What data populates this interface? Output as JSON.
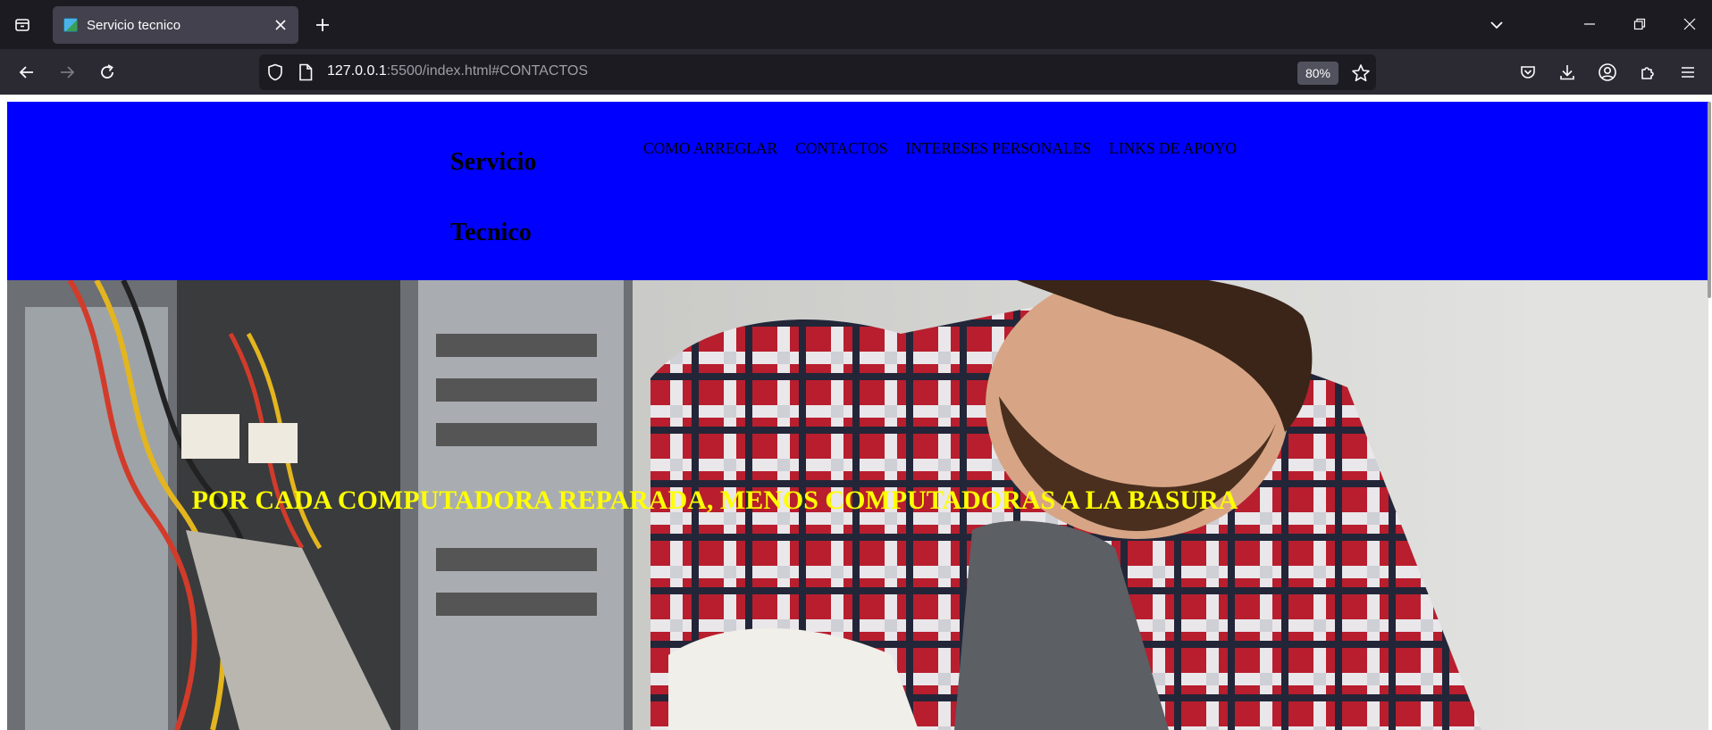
{
  "browser": {
    "tab": {
      "title": "Servicio tecnico"
    },
    "url": {
      "host": "127.0.0.1",
      "rest": ":5500/index.html#CONTACTOS"
    },
    "zoom": "80%"
  },
  "page": {
    "brand": {
      "line1": "Servicio",
      "line2": "Tecnico"
    },
    "menu": [
      "COMO ARREGLAR",
      "CONTACTOS",
      "INTERESES PERSONALES",
      "LINKS DE APOYO"
    ],
    "hero": {
      "slogan": "POR CADA COMPUTADORA REPARADA, MENOS COMPUTADORAS A LA BASURA"
    }
  },
  "colors": {
    "header_bg": "#0000ff",
    "slogan": "#ffff00",
    "chrome_dark": "#1c1b22",
    "chrome_toolbar": "#2b2a33",
    "tab_active": "#42414d"
  },
  "icons": {
    "tab_list": "tab-list-icon",
    "close": "close-icon",
    "new_tab": "plus-icon",
    "back": "back-arrow-icon",
    "forward": "forward-arrow-icon",
    "reload": "reload-icon",
    "shield": "shield-icon",
    "page": "page-icon",
    "bookmark": "star-icon",
    "pocket": "pocket-icon",
    "downloads": "download-icon",
    "account": "account-icon",
    "extensions": "extensions-icon",
    "menu": "hamburger-menu-icon"
  }
}
